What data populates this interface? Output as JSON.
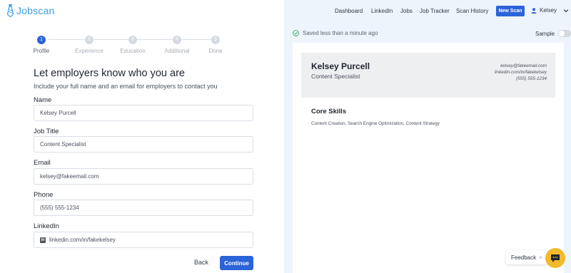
{
  "brand": {
    "name": "Jobscan",
    "color": "#3aa0e6"
  },
  "steps": [
    {
      "num": "1",
      "label": "Profile",
      "active": true
    },
    {
      "num": "2",
      "label": "Experience",
      "active": false
    },
    {
      "num": "3",
      "label": "Education",
      "active": false
    },
    {
      "num": "4",
      "label": "Additional",
      "active": false
    },
    {
      "num": "5",
      "label": "Done",
      "active": false
    }
  ],
  "form": {
    "heading": "Let employers know who you are",
    "subheading": "Include your full name and an email for employers to contact you",
    "name": {
      "label": "Name",
      "value": "Kelsey Purcell"
    },
    "job_title": {
      "label": "Job Title",
      "value": "Content Specialist"
    },
    "email": {
      "label": "Email",
      "value": "kelsey@fakeemail.com"
    },
    "phone": {
      "label": "Phone",
      "value": "(555) 555-1234"
    },
    "linkedin": {
      "label": "LinkedIn",
      "value": "linkedin.com/in/fakekelsey"
    },
    "back_label": "Back",
    "continue_label": "Continue"
  },
  "nav": {
    "links": [
      "Dashboard",
      "LinkedIn",
      "Jobs",
      "Job Tracker",
      "Scan History"
    ],
    "new_scan": "New Scan",
    "user": "Kelsey"
  },
  "status": {
    "saved": "Saved less than a minute ago",
    "sample": "Sample"
  },
  "resume": {
    "name": "Kelsey Purcell",
    "title": "Content Specialist",
    "email": "kelsey@fakeemail.com",
    "linkedin": "linkedin.com/in/fakekelsey",
    "phone": "(555) 555-1234",
    "section_title": "Core Skills",
    "skills": "Content Creation, Search Engine Optimization, Content Strategy"
  },
  "widgets": {
    "feedback": "Feedback",
    "feedback_close": "×"
  },
  "colors": {
    "primary": "#2b63d9",
    "panel": "#eef4fc",
    "chat": "#f2b92b"
  }
}
